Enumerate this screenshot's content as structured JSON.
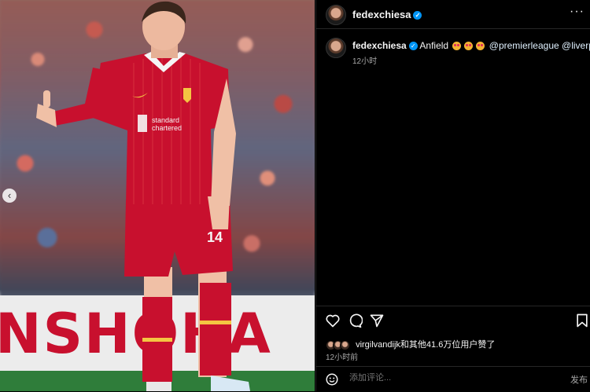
{
  "post": {
    "username": "fedexchiesa",
    "caption_location": "Anfield",
    "caption_mentions": [
      "@premierleague",
      "@liverpoolfc"
    ],
    "caption_time": "12小时",
    "liked_by_text": "virgilvandijk和其他41.6万位用户赞了",
    "post_time": "12小时前",
    "comment_placeholder": "添加评论...",
    "post_label": "发布",
    "more_label": "···"
  },
  "photo": {
    "sponsor_text": "standard\nchartered",
    "board_text": "NSHOHA",
    "shirt_number": "14"
  },
  "icons": [
    "heart-icon",
    "comment-icon",
    "share-icon",
    "bookmark-icon",
    "emoji-icon",
    "verified-icon",
    "chevron-left-icon"
  ],
  "colors": {
    "kit_red": "#c8102e",
    "verified_blue": "#0095f6",
    "background": "#000000"
  }
}
